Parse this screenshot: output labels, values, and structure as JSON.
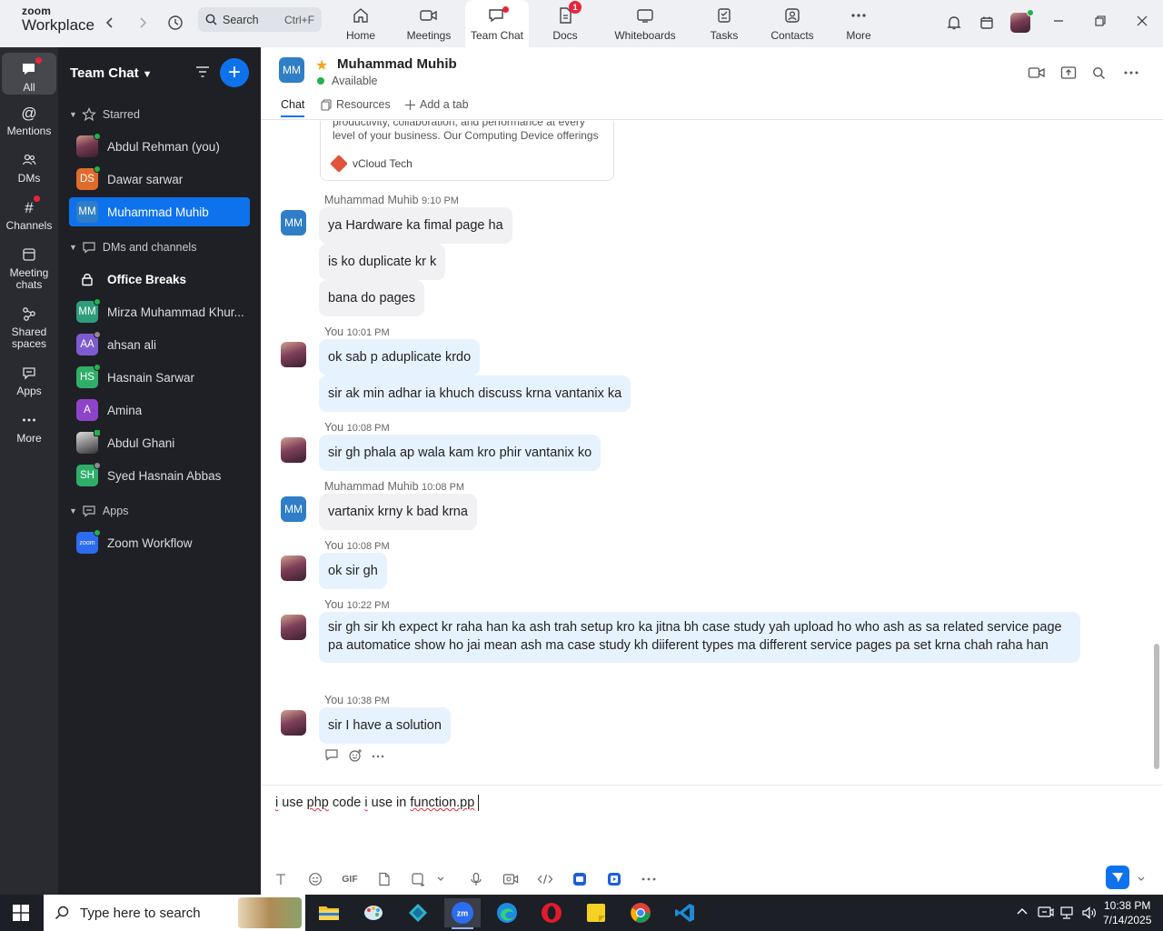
{
  "app": {
    "logo_line1": "zoom",
    "logo_line2": "Workplace"
  },
  "search": {
    "label": "Search",
    "shortcut": "Ctrl+F"
  },
  "nav_tabs": [
    {
      "label": "Home",
      "icon": "home-icon"
    },
    {
      "label": "Meetings",
      "icon": "video-camera-icon"
    },
    {
      "label": "Team Chat",
      "icon": "chat-bubble-icon",
      "active": true,
      "dot": true
    },
    {
      "label": "Docs",
      "icon": "document-icon",
      "badge": "1"
    },
    {
      "label": "Whiteboards",
      "icon": "whiteboard-icon"
    },
    {
      "label": "Tasks",
      "icon": "tasks-icon"
    },
    {
      "label": "Contacts",
      "icon": "contacts-icon"
    },
    {
      "label": "More",
      "icon": "more-dots-icon"
    }
  ],
  "rail": [
    {
      "label": "All",
      "icon": "chat-icon",
      "active": true
    },
    {
      "label": "Mentions",
      "icon": "at-icon"
    },
    {
      "label": "DMs",
      "icon": "people-icon"
    },
    {
      "label": "Channels",
      "icon": "hash-icon"
    },
    {
      "label_1": "Meeting",
      "label_2": "chats",
      "icon": "calendar-chat-icon"
    },
    {
      "label_1": "Shared",
      "label_2": "spaces",
      "icon": "shared-spaces-icon"
    },
    {
      "label": "Apps",
      "icon": "apps-icon"
    },
    {
      "label": "More",
      "icon": "more-dots-icon"
    }
  ],
  "sidebar": {
    "title": "Team Chat",
    "sections": {
      "starred": "Starred",
      "dms_channels": "DMs and channels",
      "apps": "Apps"
    },
    "starred": [
      {
        "name": "Abdul Rehman (you)",
        "avatar": "photo"
      },
      {
        "name": "Dawar sarwar",
        "initials": "DS",
        "color": "#e06c2c"
      },
      {
        "name": "Muhammad Muhib",
        "initials": "MM",
        "color": "#2f7ec7",
        "active": true
      }
    ],
    "dms": [
      {
        "name": "Office Breaks",
        "icon": "lock-icon"
      },
      {
        "name": "Mirza Muhammad Khur...",
        "initials": "MM",
        "color": "#2e9e7a"
      },
      {
        "name": "ahsan ali",
        "initials": "AA",
        "color": "#7d5bd0"
      },
      {
        "name": "Hasnain Sarwar",
        "initials": "HS",
        "color": "#2fae6a"
      },
      {
        "name": "Amina",
        "initials": "A",
        "color": "#8e44c9"
      },
      {
        "name": "Abdul Ghani",
        "avatar": "photo2"
      },
      {
        "name": "Syed Hasnain Abbas",
        "initials": "SH",
        "color": "#2fae6a"
      }
    ],
    "apps": [
      {
        "name": "Zoom Workflow",
        "initials": "zoom",
        "color": "#2d6cf0"
      }
    ]
  },
  "chat": {
    "contact_initials": "MM",
    "contact_name": "Muhammad Muhib",
    "status": "Available",
    "tabs": {
      "chat": "Chat",
      "resources": "Resources",
      "add_tab": "Add a tab"
    },
    "card": {
      "text": "productivity, collaboration, and performance at every level of your business. Our Computing Device offerings",
      "source": "vCloud Tech"
    },
    "groups": [
      {
        "sender": "Muhammad Muhib",
        "time": "9:10 PM",
        "who": "mm",
        "messages": [
          "ya Hardware ka fimal page ha",
          "is ko duplicate kr k",
          "bana do pages"
        ]
      },
      {
        "sender": "You",
        "time": "10:01 PM",
        "who": "me",
        "messages": [
          "ok sab p aduplicate krdo",
          "sir ak min adhar ia khuch discuss krna vantanix ka"
        ]
      },
      {
        "sender": "You",
        "time": "10:08 PM",
        "who": "me",
        "messages": [
          "sir gh phala ap wala kam kro phir vantanix ko"
        ]
      },
      {
        "sender": "Muhammad Muhib",
        "time": "10:08 PM",
        "who": "mm",
        "messages": [
          "vartanix krny k bad krna"
        ]
      },
      {
        "sender": "You",
        "time": "10:08 PM",
        "who": "me",
        "messages": [
          "ok sir gh"
        ]
      },
      {
        "sender": "You",
        "time": "10:22 PM",
        "who": "me",
        "messages": [
          "sir gh sir kh expect kr raha han ka ash trah setup kro ka jitna bh case study yah upload ho who ash as sa related  service page pa automatice show ho jai mean ash ma case study kh diiferent types ma  different service pages pa set  krna  chah raha han"
        ]
      },
      {
        "sender": "You",
        "time": "10:38 PM",
        "who": "me",
        "messages": [
          "sir I  have a  solution"
        ]
      }
    ]
  },
  "composer": {
    "text_parts": [
      "i",
      " use ",
      "php",
      " code ",
      "i",
      " use in ",
      "function.pp"
    ]
  },
  "taskbar": {
    "search_placeholder": "Type here to search",
    "time": "10:38 PM",
    "date": "7/14/2025"
  },
  "colors": {
    "accent": "#0e72ed",
    "sidebar_bg": "#1f2025",
    "rail_bg": "#2a2b31",
    "online": "#22b14c"
  }
}
